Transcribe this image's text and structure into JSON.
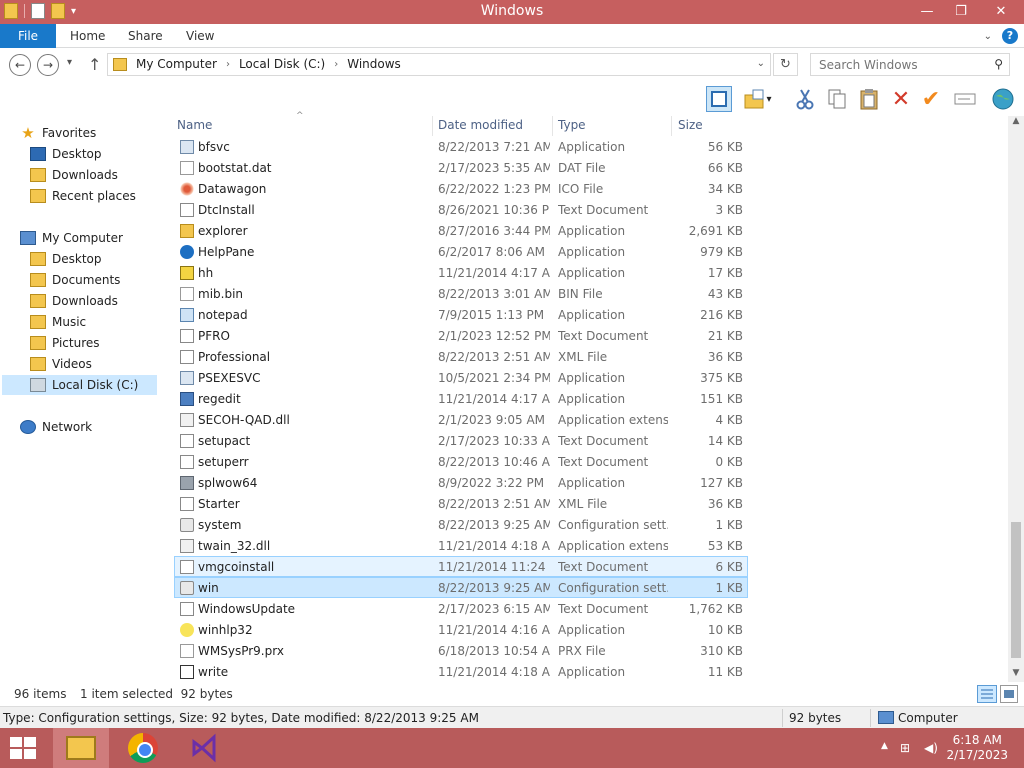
{
  "window": {
    "title": "Windows",
    "controls": {
      "minimize": "—",
      "maximize": "❐",
      "close": "✕"
    }
  },
  "qat": {
    "dropdown": "▾"
  },
  "ribbon": {
    "tabs": [
      "File",
      "Home",
      "Share",
      "View"
    ],
    "collapse": "⌄",
    "help": "?"
  },
  "nav": {
    "back": "←",
    "forward": "→",
    "recent": "▾",
    "up": "↑"
  },
  "address": {
    "crumbs": [
      "My Computer",
      "Local Disk (C:)",
      "Windows"
    ],
    "separator": "›",
    "dropdown": "⌄",
    "refresh": "↻"
  },
  "search": {
    "placeholder": "Search Windows",
    "icon": "⚲"
  },
  "toolbar": {
    "icons": [
      "preview-pane-icon",
      "new-folder-icon",
      "cut-icon",
      "copy-icon",
      "paste-icon",
      "delete-icon",
      "checkmark-icon",
      "rename-icon",
      "globe-icon"
    ],
    "dropdown": "▾"
  },
  "navpane": {
    "favorites": {
      "label": "Favorites",
      "items": [
        "Desktop",
        "Downloads",
        "Recent places"
      ]
    },
    "computer": {
      "label": "My Computer",
      "items": [
        "Desktop",
        "Documents",
        "Downloads",
        "Music",
        "Pictures",
        "Videos",
        "Local Disk (C:)"
      ]
    },
    "network": {
      "label": "Network"
    },
    "selected": "Local Disk (C:)"
  },
  "columns": {
    "name": "Name",
    "date": "Date modified",
    "type": "Type",
    "size": "Size",
    "sort_indicator": "^"
  },
  "files": [
    {
      "name": "bfsvc",
      "date": "8/22/2013 7:21 AM",
      "type": "Application",
      "size": "56 KB",
      "icon": "app"
    },
    {
      "name": "bootstat.dat",
      "date": "2/17/2023 5:35 AM",
      "type": "DAT File",
      "size": "66 KB",
      "icon": "dat"
    },
    {
      "name": "Datawagon",
      "date": "6/22/2022 1:23 PM",
      "type": "ICO File",
      "size": "34 KB",
      "icon": "ico"
    },
    {
      "name": "DtcInstall",
      "date": "8/26/2021 10:36 PM",
      "type": "Text Document",
      "size": "3 KB",
      "icon": "txt"
    },
    {
      "name": "explorer",
      "date": "8/27/2016 3:44 PM",
      "type": "Application",
      "size": "2,691 KB",
      "icon": "exp"
    },
    {
      "name": "HelpPane",
      "date": "6/2/2017 8:06 AM",
      "type": "Application",
      "size": "979 KB",
      "icon": "help"
    },
    {
      "name": "hh",
      "date": "11/21/2014 4:17 AM",
      "type": "Application",
      "size": "17 KB",
      "icon": "hh"
    },
    {
      "name": "mib.bin",
      "date": "8/22/2013 3:01 AM",
      "type": "BIN File",
      "size": "43 KB",
      "icon": "dat"
    },
    {
      "name": "notepad",
      "date": "7/9/2015 1:13 PM",
      "type": "Application",
      "size": "216 KB",
      "icon": "note"
    },
    {
      "name": "PFRO",
      "date": "2/1/2023 12:52 PM",
      "type": "Text Document",
      "size": "21 KB",
      "icon": "txt"
    },
    {
      "name": "Professional",
      "date": "8/22/2013 2:51 AM",
      "type": "XML File",
      "size": "36 KB",
      "icon": "xml"
    },
    {
      "name": "PSEXESVC",
      "date": "10/5/2021 2:34 PM",
      "type": "Application",
      "size": "375 KB",
      "icon": "app"
    },
    {
      "name": "regedit",
      "date": "11/21/2014 4:17 AM",
      "type": "Application",
      "size": "151 KB",
      "icon": "reg"
    },
    {
      "name": "SECOH-QAD.dll",
      "date": "2/1/2023 9:05 AM",
      "type": "Application extens...",
      "size": "4 KB",
      "icon": "dll"
    },
    {
      "name": "setupact",
      "date": "2/17/2023 10:33 AM",
      "type": "Text Document",
      "size": "14 KB",
      "icon": "txt"
    },
    {
      "name": "setuperr",
      "date": "8/22/2013 10:46 AM",
      "type": "Text Document",
      "size": "0 KB",
      "icon": "txt"
    },
    {
      "name": "splwow64",
      "date": "8/9/2022 3:22 PM",
      "type": "Application",
      "size": "127 KB",
      "icon": "print"
    },
    {
      "name": "Starter",
      "date": "8/22/2013 2:51 AM",
      "type": "XML File",
      "size": "36 KB",
      "icon": "xml"
    },
    {
      "name": "system",
      "date": "8/22/2013 9:25 AM",
      "type": "Configuration sett...",
      "size": "1 KB",
      "icon": "cfg"
    },
    {
      "name": "twain_32.dll",
      "date": "11/21/2014 4:18 AM",
      "type": "Application extens...",
      "size": "53 KB",
      "icon": "dll"
    },
    {
      "name": "vmgcoinstall",
      "date": "11/21/2014 11:24 ...",
      "type": "Text Document",
      "size": "6 KB",
      "icon": "txt",
      "state": "hover"
    },
    {
      "name": "win",
      "date": "8/22/2013 9:25 AM",
      "type": "Configuration sett...",
      "size": "1 KB",
      "icon": "cfg",
      "state": "selected"
    },
    {
      "name": "WindowsUpdate",
      "date": "2/17/2023 6:15 AM",
      "type": "Text Document",
      "size": "1,762 KB",
      "icon": "txt"
    },
    {
      "name": "winhlp32",
      "date": "11/21/2014 4:16 AM",
      "type": "Application",
      "size": "10 KB",
      "icon": "winhlp"
    },
    {
      "name": "WMSysPr9.prx",
      "date": "6/18/2013 10:54 AM",
      "type": "PRX File",
      "size": "310 KB",
      "icon": "dat"
    },
    {
      "name": "write",
      "date": "11/21/2014 4:18 AM",
      "type": "Application",
      "size": "11 KB",
      "icon": "write"
    }
  ],
  "scrollbar": {
    "up": "▲",
    "down": "▼"
  },
  "status": {
    "items": "96 items",
    "selection": "1 item selected  92 bytes"
  },
  "details": {
    "text": "Type: Configuration settings, Size: 92 bytes, Date modified: 8/22/2013 9:25 AM",
    "size": "92 bytes",
    "location": "Computer"
  },
  "taskbar": {
    "apps": [
      "file-explorer",
      "chrome",
      "visual-studio"
    ],
    "tray": {
      "chevron": "▲",
      "network": "⊞",
      "volume": "◀)"
    },
    "time": "6:18 AM",
    "date": "2/17/2023"
  },
  "colors": {
    "titlebar": "#c65f5f",
    "file_tab": "#1979ca",
    "selection": "#cce8ff",
    "taskbar": "#b85b5b"
  }
}
